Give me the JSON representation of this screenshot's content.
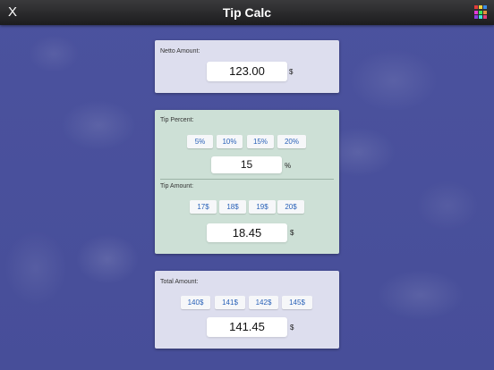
{
  "header": {
    "close_label": "X",
    "title": "Tip Calc",
    "apps_icon_colors": [
      "#e43b3b",
      "#f2d23b",
      "#3b8be4",
      "#e43bd9",
      "#3be45a",
      "#e4933b",
      "#8b3be4",
      "#3be4d9",
      "#e43b7d"
    ]
  },
  "netto": {
    "label": "Netto Amount:",
    "value": "123.00",
    "unit": "$"
  },
  "tip_percent": {
    "label": "Tip Percent:",
    "presets": [
      "5%",
      "10%",
      "15%",
      "20%"
    ],
    "value": "15",
    "unit": "%"
  },
  "tip_amount": {
    "label": "Tip Amount:",
    "presets": [
      "17$",
      "18$",
      "19$",
      "20$"
    ],
    "value": "18.45",
    "unit": "$"
  },
  "total": {
    "label": "Total Amount:",
    "presets": [
      "140$",
      "141$",
      "142$",
      "145$"
    ],
    "value": "141.45",
    "unit": "$"
  }
}
